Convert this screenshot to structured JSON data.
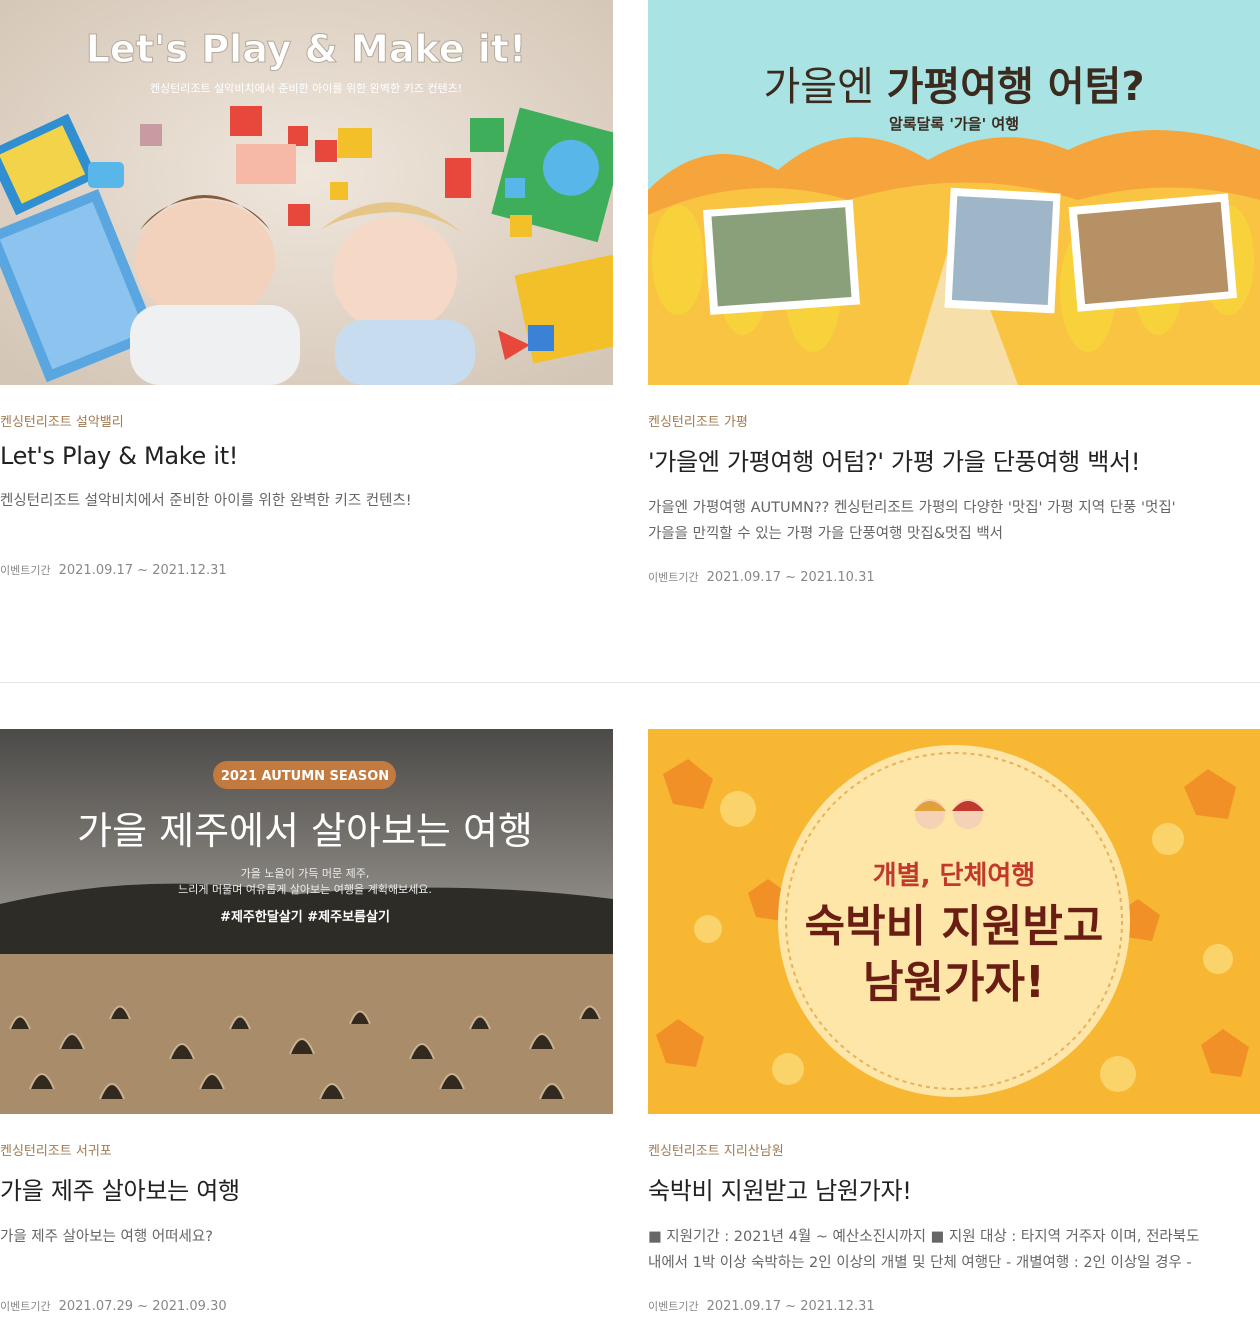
{
  "cards": [
    {
      "resort": "켄싱턴리조트 설악밸리",
      "title": "Let's Play & Make it!",
      "desc_lines": [
        "켄싱턴리조트 설악비치에서 준비한 아이를 위한 완벽한 키즈 컨텐츠!",
        ""
      ],
      "period_label": "이벤트기간",
      "period": "2021.09.17 ~ 2021.12.31",
      "banner": {
        "headline": "Let's Play & Make it!",
        "sub": "켄싱턴리조트 설악비치에서 준비한 아이를 위한 완벽한 키즈 컨텐츠!"
      }
    },
    {
      "resort": "켄싱턴리조트 가평",
      "title": "'가을엔 가평여행 어텀?' 가평 가을 단풍여행 백서!",
      "desc_lines": [
        "가을엔 가평여행 AUTUMN?? 켄싱턴리조트 가평의 다양한 '맛집' 가평 지역 단풍 '멋집'",
        "가을을 만끽할 수 있는 가평 가을 단풍여행 맛집&멋집 백서"
      ],
      "period_label": "이벤트기간",
      "period": "2021.09.17 ~ 2021.10.31",
      "banner": {
        "headline_a": "가을엔",
        "headline_b": "가평여행 어텀?",
        "sub": "알록달록 '가을' 여행"
      }
    },
    {
      "resort": "켄싱턴리조트 서귀포",
      "title": "가을 제주 살아보는 여행",
      "desc_lines": [
        "가을 제주 살아보는 여행 어떠세요?",
        ""
      ],
      "period_label": "이벤트기간",
      "period": "2021.07.29 ~ 2021.09.30",
      "banner": {
        "badge": "2021 AUTUMN SEASON",
        "headline": "가을 제주에서 살아보는 여행",
        "sub1": "가을 노을이 가득 머문 제주,",
        "sub2": "느리게 머물며 여유롭게 살아보는 여행을 계획해보세요.",
        "tags": "#제주한달살기 #제주보름살기"
      }
    },
    {
      "resort": "켄싱턴리조트 지리산남원",
      "title": "숙박비 지원받고 남원가자!",
      "desc_lines": [
        "■ 지원기간 : 2021년 4월 ~ 예산소진시까지 ■ 지원 대상 : 타지역 거주자 이며, 전라북도",
        "내에서 1박 이상 숙박하는 2인 이상의 개별 및 단체 여행단 - 개별여행 : 2인 이상일 경우 -"
      ],
      "period_label": "이벤트기간",
      "period": "2021.09.17 ~ 2021.12.31",
      "banner": {
        "top": "개별, 단체여행",
        "line1": "숙박비 지원받고",
        "line2": "남원가자!"
      }
    }
  ],
  "colors": {
    "resort_text": "#a07a52",
    "banner4_bg": "#f7b733",
    "banner4_circle": "#fde6a8",
    "banner4_text": "#6a1d12"
  }
}
